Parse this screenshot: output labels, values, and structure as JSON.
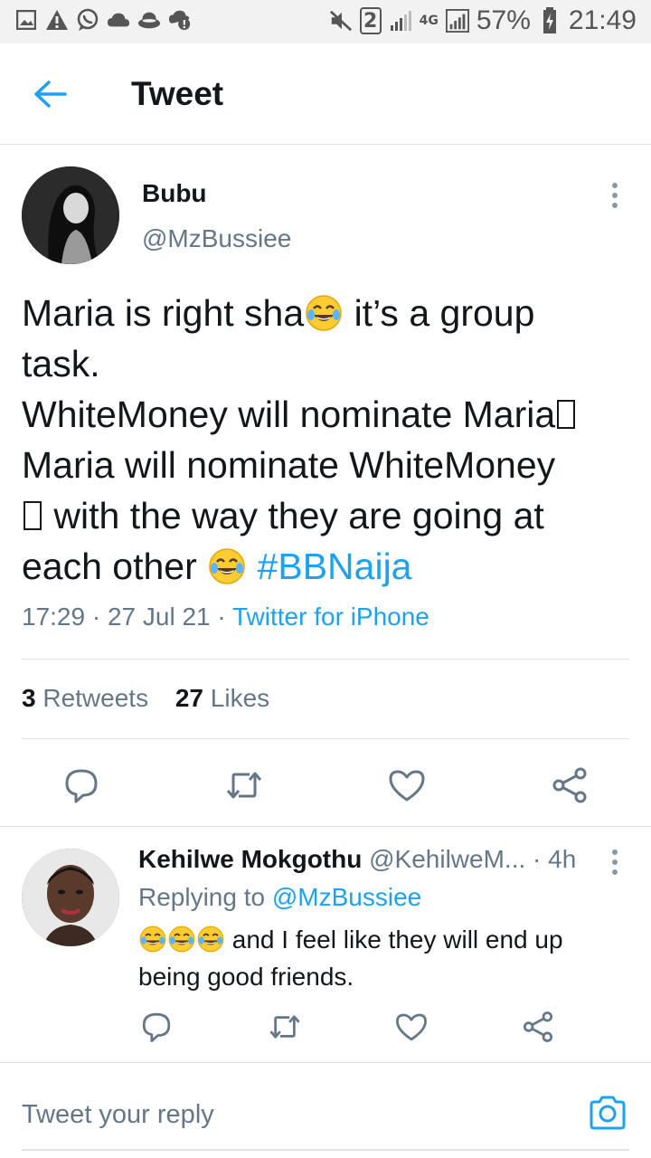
{
  "status_bar": {
    "sim_label": "2",
    "network": "4G",
    "battery": "57%",
    "time": "21:49"
  },
  "header": {
    "title": "Tweet"
  },
  "tweet": {
    "author_name": "Bubu",
    "author_handle": "@MzBussiee",
    "text_lines": [
      "Maria is right sha",
      " it’s a group",
      "task.",
      "WhiteMoney will nominate Maria",
      "Maria will nominate WhiteMoney",
      " with the way they are going at",
      "each other "
    ],
    "hashtag": "#BBNaija",
    "time": "17:29",
    "date": "27 Jul 21",
    "source": "Twitter for iPhone",
    "retweets_count": "3",
    "retweets_label": "Retweets",
    "likes_count": "27",
    "likes_label": "Likes"
  },
  "reply": {
    "author_name": "Kehilwe Mokgothu",
    "author_handle": "@KehilweM...",
    "time_ago": "4h",
    "replying_prefix": "Replying to",
    "replying_to": "@MzBussiee",
    "text_line1": " and I feel like they will end up",
    "text_line2": "being good friends."
  },
  "compose": {
    "placeholder": "Tweet your reply"
  },
  "colors": {
    "accent": "#1da1f2",
    "secondary_text": "#657786",
    "divider": "#dfe3e6"
  },
  "icons": {
    "back": "arrow-left-icon",
    "more": "vertical-dots-icon",
    "reply": "speech-bubble-icon",
    "retweet": "retweet-icon",
    "like": "heart-icon",
    "share": "share-icon",
    "camera": "camera-icon",
    "emoji": "face-with-tears-of-joy-emoji"
  }
}
